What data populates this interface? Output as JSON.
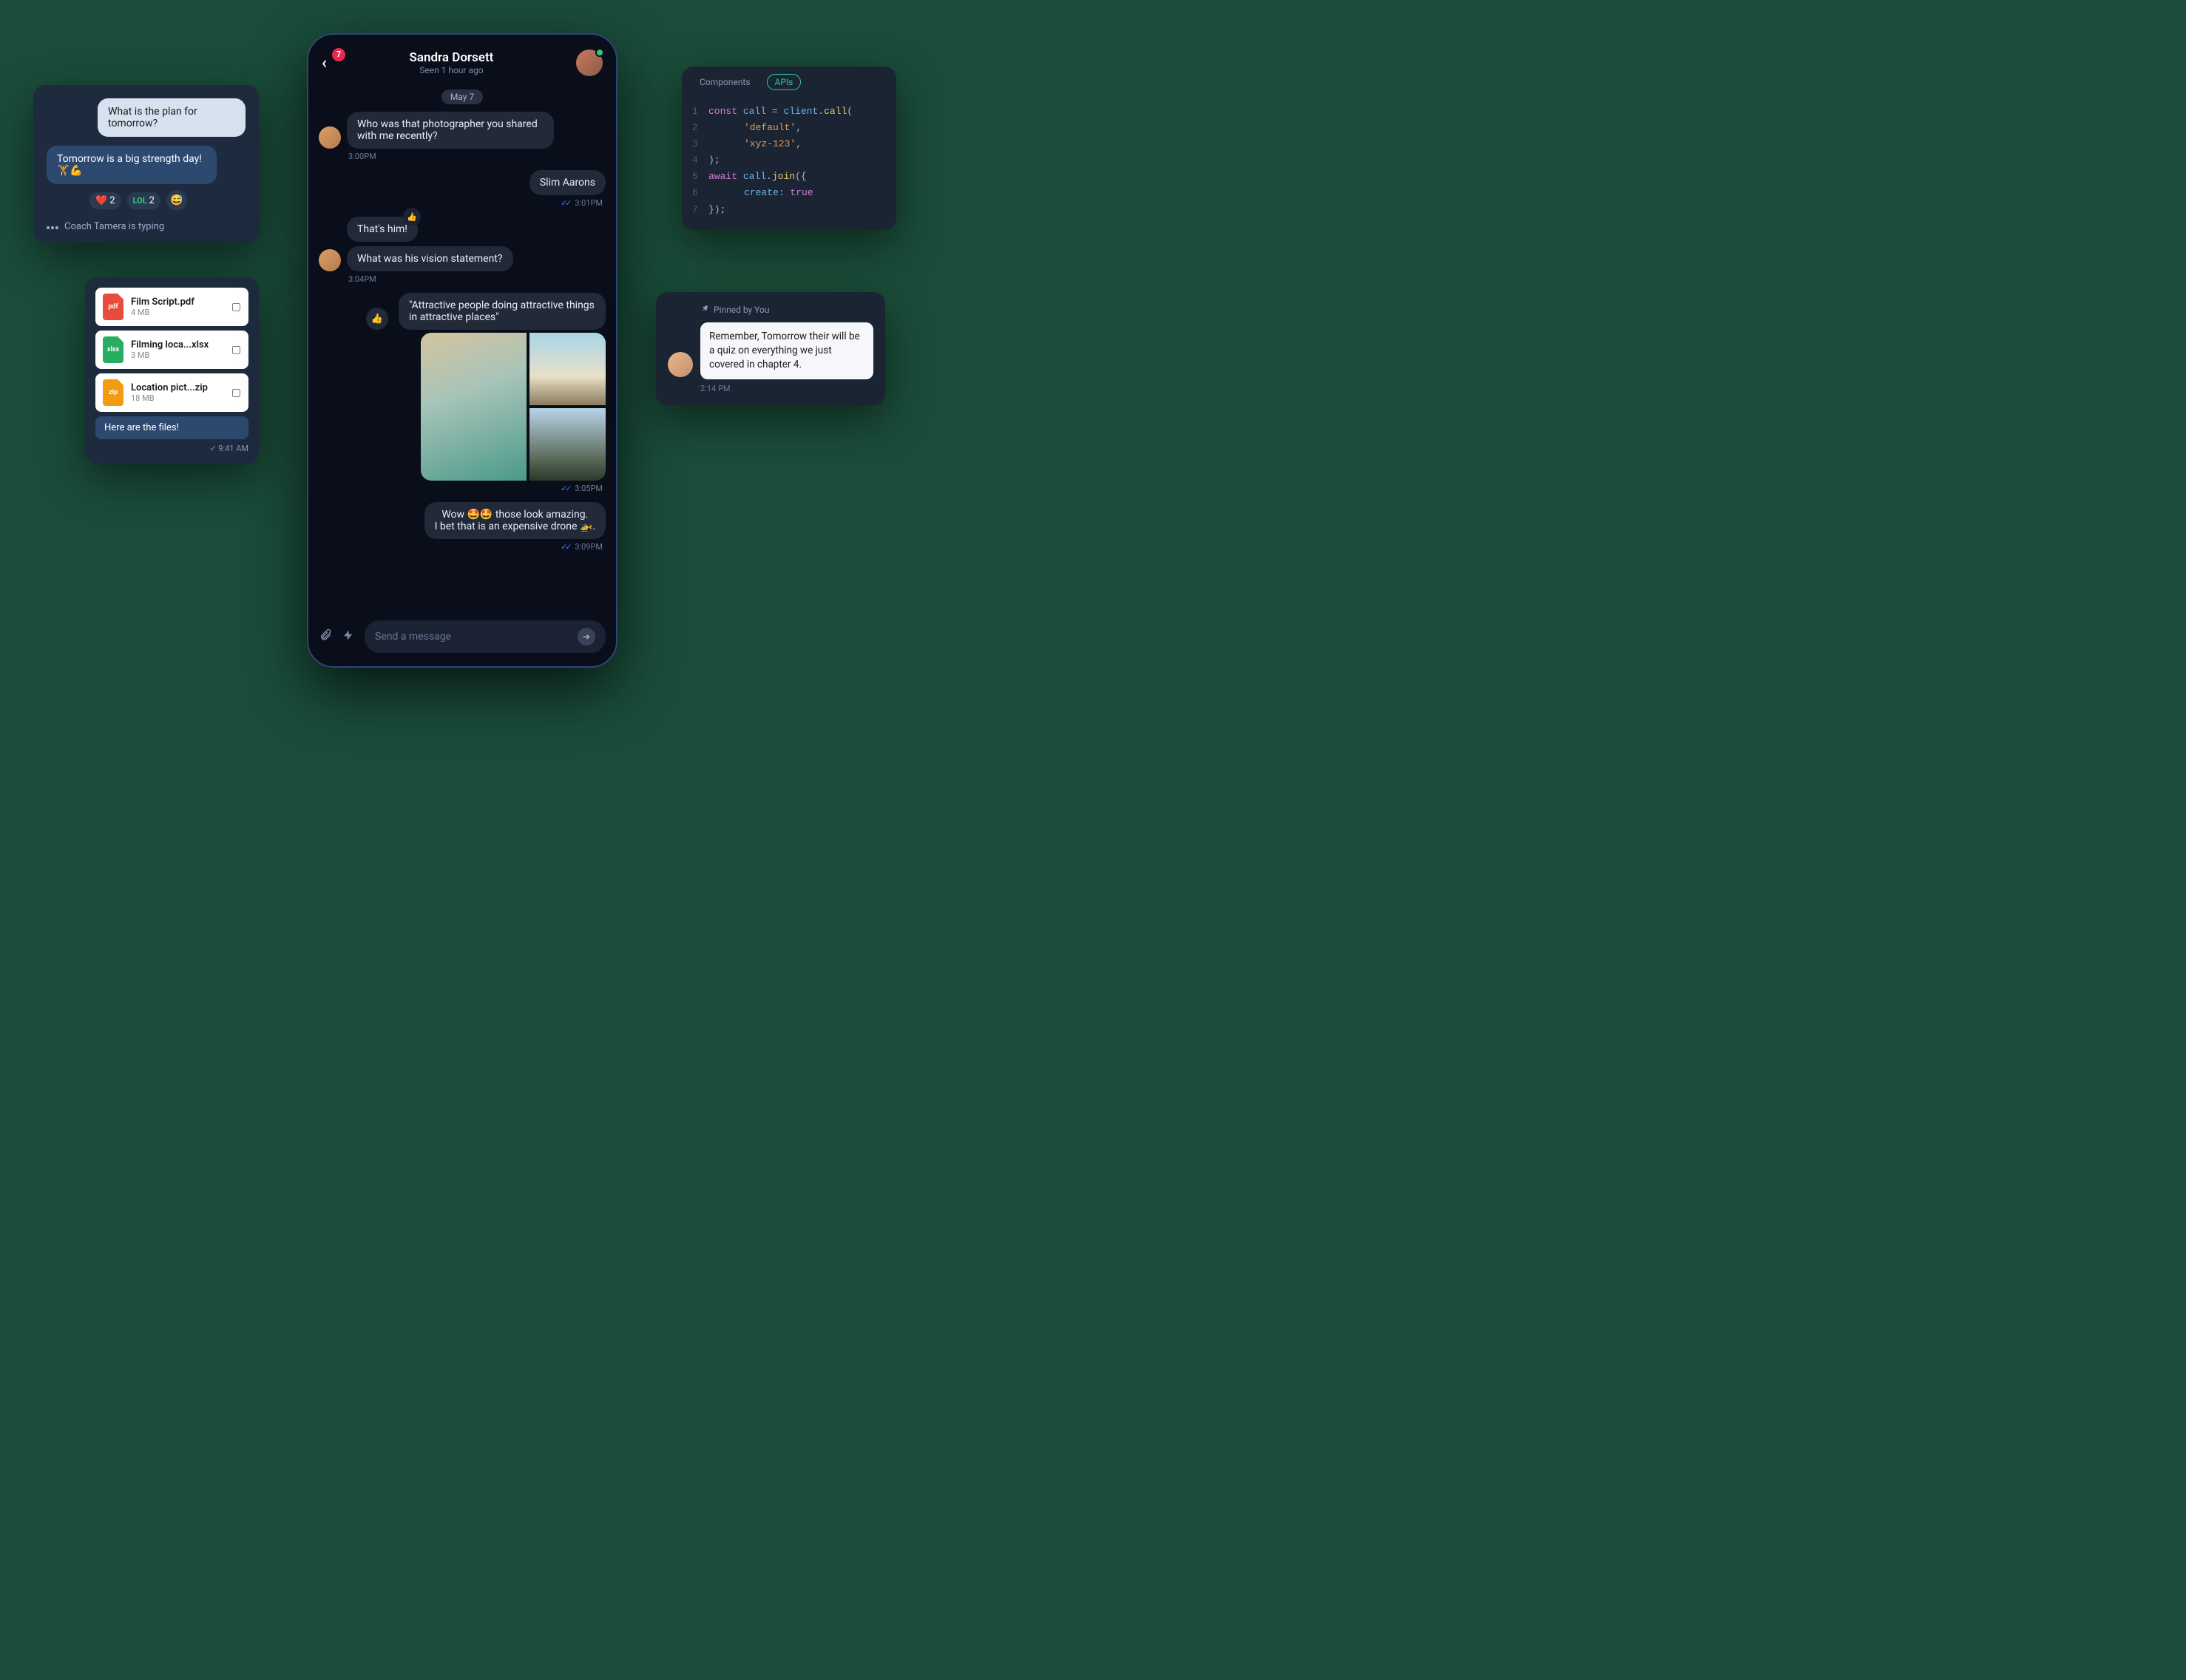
{
  "coach": {
    "incoming": "What is the plan for tomorrow?",
    "outgoing": "Tomorrow is a big strength day! 🏋️💪",
    "reactions": [
      {
        "emoji": "❤️",
        "count": "2"
      },
      {
        "emoji": "LOL",
        "count": "2"
      }
    ],
    "reaction_circle": "😅",
    "typing": "Coach Tamera is typing"
  },
  "files": {
    "items": [
      {
        "name": "Film Script.pdf",
        "size": "4 MB",
        "type": "pdf"
      },
      {
        "name": "Filming loca...xlsx",
        "size": "3 MB",
        "type": "xlsx"
      },
      {
        "name": "Location pict...zip",
        "size": "18 MB",
        "type": "zip"
      }
    ],
    "caption": "Here are the files!",
    "time": "9:41 AM"
  },
  "phone": {
    "badge": "7",
    "name": "Sandra Dorsett",
    "seen": "Seen 1 hour ago",
    "date": "May 7",
    "messages": {
      "m1": "Who was that photographer you shared with me recently?",
      "t1": "3:00PM",
      "m2": "Slim Aarons",
      "t2": "3:01PM",
      "m3": "That's him!",
      "m4": "What was his vision statement?",
      "t4": "3:04PM",
      "m5": "\"Attractive people doing attractive things in attractive places\"",
      "t5": "3:05PM",
      "m6a": "Wow 🤩🤩 those look amazing.",
      "m6b": "I bet that is an expensive drone 🚁.",
      "t6": "3:09PM"
    },
    "input_placeholder": "Send a message"
  },
  "code": {
    "tabs": {
      "a": "Components",
      "b": "APIs"
    },
    "lines": {
      "l1": {
        "n": "1"
      },
      "l2": {
        "n": "2",
        "str": "'default'"
      },
      "l3": {
        "n": "3",
        "str": "'xyz-123'"
      },
      "l4": {
        "n": "4"
      },
      "l5": {
        "n": "5"
      },
      "l6": {
        "n": "6"
      },
      "l7": {
        "n": "7"
      }
    },
    "tokens": {
      "const": "const",
      "call": "call",
      "eq": " = ",
      "client": "client",
      "dot": ".",
      "callfn": "call",
      "lp": "(",
      "rp": ")",
      "comma": ",",
      "semi": ";",
      "await": "await",
      "join": "join",
      "lb": "({",
      "rb": "})",
      "create": "create",
      "colon": ": ",
      "true": "true"
    }
  },
  "pinned": {
    "header": "Pinned by You",
    "text": "Remember, Tomorrow their will be a quiz on everything we just covered in chapter 4.",
    "time": "2:14 PM"
  }
}
